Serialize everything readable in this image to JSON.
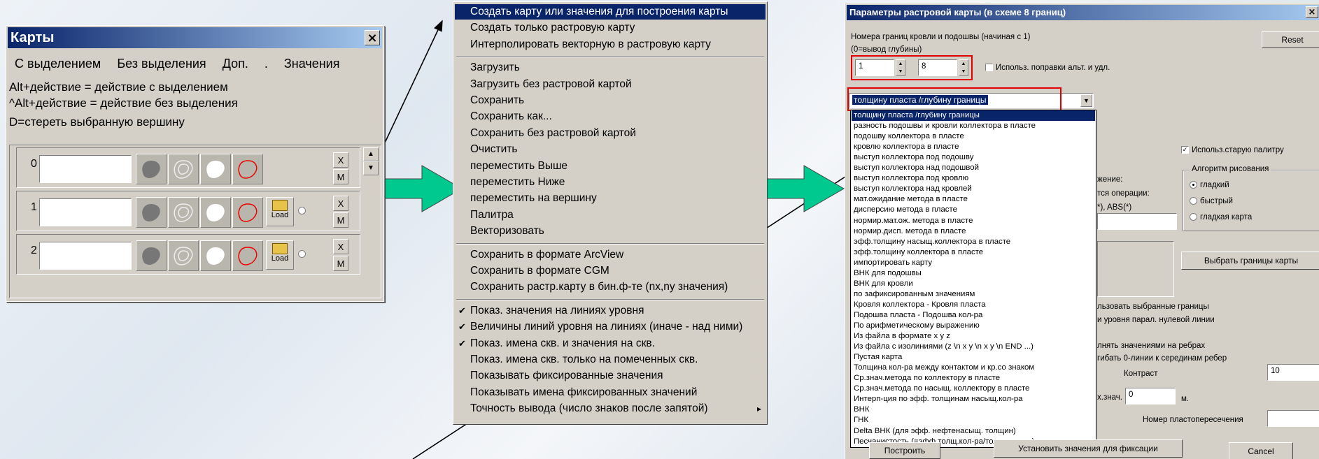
{
  "maps_window": {
    "title": "Карты",
    "close": "×",
    "menu": [
      "С выделением",
      "Без выделения",
      "Доп.",
      ".",
      "Значения"
    ],
    "help": [
      "Alt+действие = действие с выделением",
      "^Alt+действие = действие без выделения",
      "D=стереть выбранную вершину"
    ],
    "rows": [
      {
        "index": "0",
        "has_load": false
      },
      {
        "index": "1",
        "has_load": true
      },
      {
        "index": "2",
        "has_load": true
      }
    ],
    "row_x": "X",
    "row_m": "M",
    "load_label": "Load"
  },
  "context_menu": {
    "groups": [
      [
        "Создать карту или значения для построения карты",
        "Создать только растровую карту",
        "Интерполировать векторную в растровую карту"
      ],
      [
        "Загрузить",
        "Загрузить без растровой картой",
        "Сохранить",
        "Сохранить как...",
        "Сохранить без растровой картой",
        "Очистить",
        "переместить Выше",
        "переместить Ниже",
        "переместить на вершину",
        "Палитра",
        "Векторизовать"
      ],
      [
        "Сохранить в формате ArcView",
        "Сохранить в формате CGM",
        "Сохранить растр.карту в бин.ф-те (nx,ny значения)"
      ],
      [
        "Показ. значения на линиях уровня",
        "Величины линий уровня на линиях (иначе - над ними)",
        "Показ. имена скв. и значения на скв.",
        "Показ. имена скв. только на помеченных скв.",
        "Показывать фиксированные значения",
        "Показывать имена фиксированных значений",
        "Точность вывода (число знаков после запятой)"
      ]
    ],
    "checked": [
      "Показ. значения на линиях уровня",
      "Величины линий уровня на линиях (иначе - над ними)",
      "Показ. имена скв. и значения на скв."
    ],
    "highlighted": "Создать карту или значения для построения карты",
    "submenu_arrow": "▸"
  },
  "dialog": {
    "title": "Параметры растровой карты (в схеме 8 границ)",
    "close": "×",
    "label_bounds": "Номера границ кровли и подошвы  (начиная с 1)",
    "label_depth": "(0=вывод глубины)",
    "top_value": "1",
    "bottom_value": "8",
    "alt_checkbox": "Использ. поправки альт. и удл.",
    "reset": "Reset",
    "combo_value": "толщину пласта /глубину границы",
    "list_items": [
      "толщину пласта /глубину границы",
      "разность подошвы и кровли коллектора в пласте",
      "подошву коллектора в пласте",
      "кровлю коллектора в пласте",
      "выступ коллектора под подошву",
      "выступ коллектора над подошвой",
      "выступ коллектора под кровлю",
      "выступ коллектора над кровлей",
      "мат.ожидание метода в пласте",
      "дисперсию метода в пласте",
      "нормир.мат.ож. метода в пласте",
      "нормир.дисп. метода в пласте",
      "эфф.толщину насыщ.коллектора в пласте",
      "эфф.толщину коллектора в пласте",
      "импортировать карту",
      "ВНК для подошвы",
      "ВНК для кровли",
      "по зафиксированным значениям",
      "Кровля коллектора - Кровля пласта",
      "Подошва пласта - Подошва кол-ра",
      "По арифметическому выражению",
      "Из файла в формате x y z",
      "Из файла с изолиниями (z \\n x y \\n x y \\n END ...)",
      "Пустая карта",
      "Толщина кол-ра между контактом и кр.со знаком",
      "Ср.знач.метода по коллектору в пласте",
      "Ср.знач.метода по насыщ. коллектору в пласте",
      "Интерп-ция по эфф. толщинам насыщ.кол-ра",
      "ВНК",
      "ГНК",
      "Delta ВНК (для эфф. нефтенасыщ. толщин)",
      "Песчанистость (=эфф.толщ.кол-ра/толщ.пласта)"
    ],
    "old_palette": "Использ.старую палитру",
    "algo_label": "Алгоритм рисования",
    "algo_options": [
      "гладкий",
      "быстрый",
      "гладкая карта"
    ],
    "partial_expr": "жение:",
    "partial_ops": "тся операции:",
    "partial_abs": "*), ABS(*)",
    "choose_bounds": "Выбрать границы карты",
    "partial_use": "льзовать выбранные границы",
    "partial_level": "и уровня парал. нулевой линии",
    "partial_fill": "лнять значениями на ребрах",
    "partial_bend": "гибать 0-линии к серединам ребер",
    "contrast_label": "Контраст",
    "contrast_value": "10",
    "partial_max": "x.знач.",
    "max_value": "0",
    "unit_m": "м.",
    "intersection_label": "Номер пластопересечения",
    "build": "Построить",
    "fix_values": "Установить значения для фиксации",
    "cancel": "Cancel"
  }
}
